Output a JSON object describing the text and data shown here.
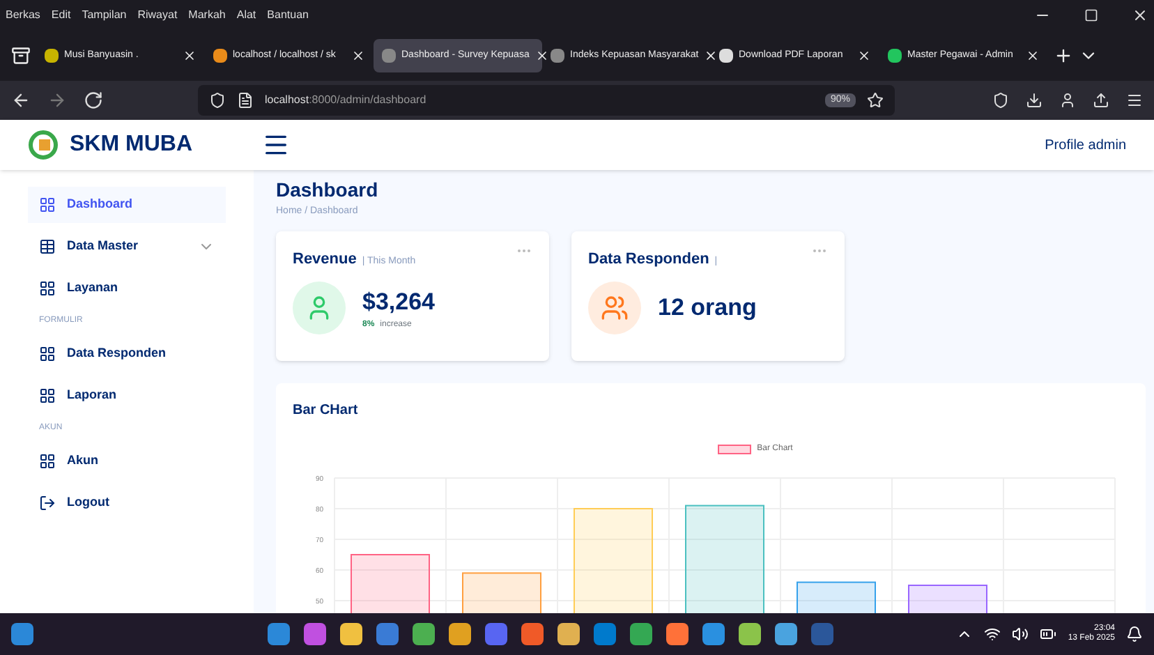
{
  "browser": {
    "menu": [
      "Berkas",
      "Edit",
      "Tampilan",
      "Riwayat",
      "Markah",
      "Alat",
      "Bantuan"
    ],
    "tabs": [
      {
        "label": "Musi Banyuasin .",
        "selected": false,
        "color": "#c8b400"
      },
      {
        "label": "localhost / localhost / sk",
        "selected": false,
        "color": "#e98b1a"
      },
      {
        "label": "Dashboard - Survey Kepuasa",
        "selected": true,
        "color": "#888888"
      },
      {
        "label": "Indeks Kepuasan Masyarakat",
        "selected": false,
        "color": "#888888"
      },
      {
        "label": "Download PDF Laporan",
        "selected": false,
        "color": "#dddddd"
      },
      {
        "label": "Master Pegawai - Admin",
        "selected": false,
        "color": "#22c55e"
      }
    ],
    "url_host": "localhost",
    "url_path": ":8000/admin/dashboard",
    "zoom": "90%"
  },
  "app": {
    "brand": "SKM MUBA",
    "profile": "Profile admin"
  },
  "sidebar": [
    {
      "kind": "link",
      "label": "Dashboard",
      "selected": true
    },
    {
      "kind": "dropdown",
      "label": "Data Master",
      "selected": false
    },
    {
      "kind": "link",
      "label": "Layanan",
      "selected": false
    },
    {
      "kind": "heading",
      "label": "FORMULIR"
    },
    {
      "kind": "link",
      "label": "Data Responden",
      "selected": false
    },
    {
      "kind": "link",
      "label": "Laporan",
      "selected": false
    },
    {
      "kind": "heading",
      "label": "AKUN"
    },
    {
      "kind": "link",
      "label": "Akun",
      "selected": false
    },
    {
      "kind": "logout",
      "label": "Logout",
      "selected": false
    }
  ],
  "page": {
    "title": "Dashboard",
    "breadcrumb": "Home / Dashboard"
  },
  "cards": [
    {
      "title": "Revenue",
      "subtitle": "| This Month",
      "value": "$3,264",
      "change": "8%",
      "change_label": "increase",
      "color": "#e0f8e9"
    },
    {
      "title": "Data Responden",
      "subtitle": "|",
      "value": "12 orang",
      "color": "#ffecdf"
    }
  ],
  "chart": {
    "title": "Bar CHart",
    "chart_data": {
      "type": "bar",
      "grid": true,
      "series": [
        {
          "name": "Bar Chart",
          "values": [
            65,
            59,
            80,
            81,
            56,
            55,
            null
          ]
        }
      ],
      "ylim": [
        40,
        90
      ],
      "yticks": [
        50,
        60,
        70,
        80,
        90
      ]
    }
  },
  "taskbar": {
    "time": "23:04",
    "date": "13 Feb 2025"
  }
}
